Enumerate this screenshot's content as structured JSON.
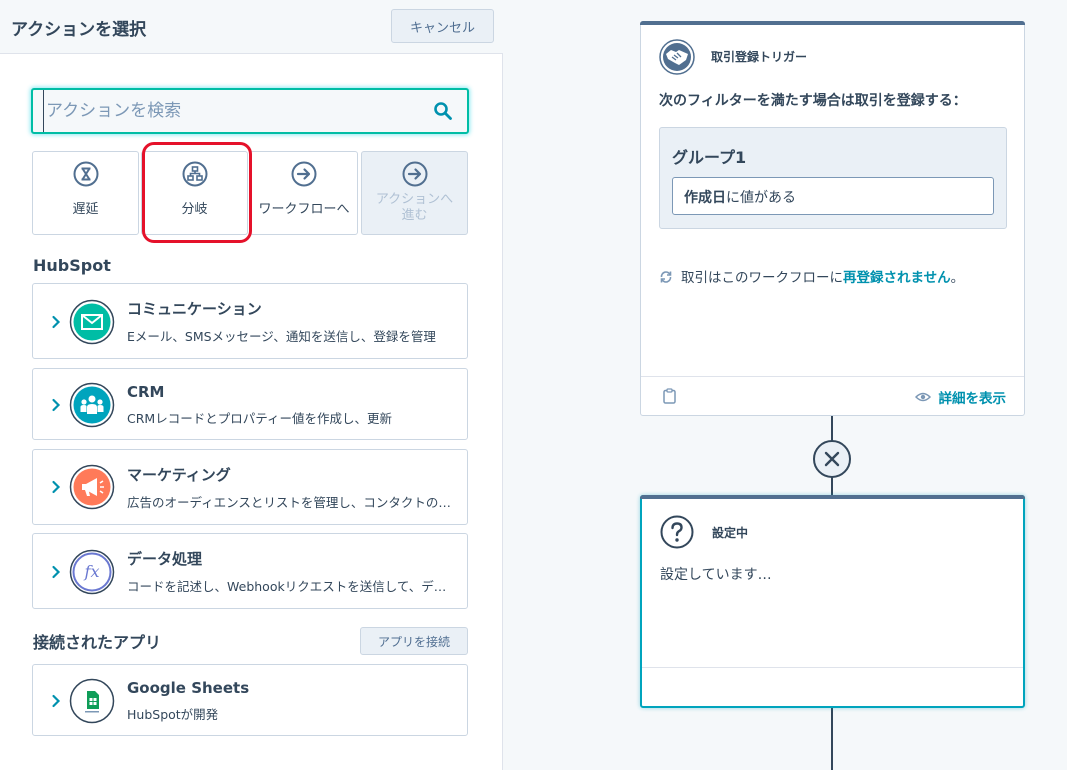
{
  "panel": {
    "title": "アクションを選択",
    "cancel_label": "キャンセル",
    "search": {
      "placeholder": "アクションを検索",
      "value": ""
    }
  },
  "tiles": [
    {
      "label": "遅延",
      "icon": "hourglass-icon",
      "disabled": false
    },
    {
      "label": "分岐",
      "icon": "branch-icon",
      "disabled": false
    },
    {
      "label": "ワークフローへ",
      "icon": "arrow-circle-icon",
      "disabled": false
    },
    {
      "label": "アクションへ進む",
      "icon": "arrow-circle-icon",
      "disabled": true
    }
  ],
  "sections": {
    "hubspot": "HubSpot",
    "connected_apps": "接続されたアプリ",
    "connect_app_label": "アプリを接続"
  },
  "categories": [
    {
      "title": "コミュニケーション",
      "desc": "Eメール、SMSメッセージ、通知を送信し、登録を管理",
      "icon": "envelope-icon",
      "color": "#00bda5"
    },
    {
      "title": "CRM",
      "desc": "CRMレコードとプロパティー値を作成し、更新",
      "icon": "contacts-icon",
      "color": "#00a4bd"
    },
    {
      "title": "マーケティング",
      "desc": "広告のオーディエンスとリストを管理し、コンタクトの…",
      "icon": "megaphone-icon",
      "color": "#ff7a59"
    },
    {
      "title": "データ処理",
      "desc": "コードを記述し、Webhookリクエストを送信して、デ…",
      "icon": "function-icon",
      "color": "#6a78d1"
    }
  ],
  "apps": [
    {
      "title": "Google Sheets",
      "desc": "HubSpotが開発",
      "icon": "google-sheets-icon"
    }
  ],
  "trigger_node": {
    "title": "取引登録トリガー",
    "filter_label": "次のフィルターを満たす場合は取引を登録する：",
    "group_title": "グループ1",
    "condition_property": "作成日",
    "condition_text": "に値がある",
    "reenroll_text": "取引はこのワークフローに",
    "reenroll_link": "再登録されません",
    "reenroll_end": "。",
    "details_label": "詳細を表示"
  },
  "setting_node": {
    "title": "設定中",
    "text": "設定しています…"
  },
  "colors": {
    "accent": "#00bda5",
    "link": "#0091ae",
    "highlight": "#e5112a",
    "text": "#33475b"
  }
}
